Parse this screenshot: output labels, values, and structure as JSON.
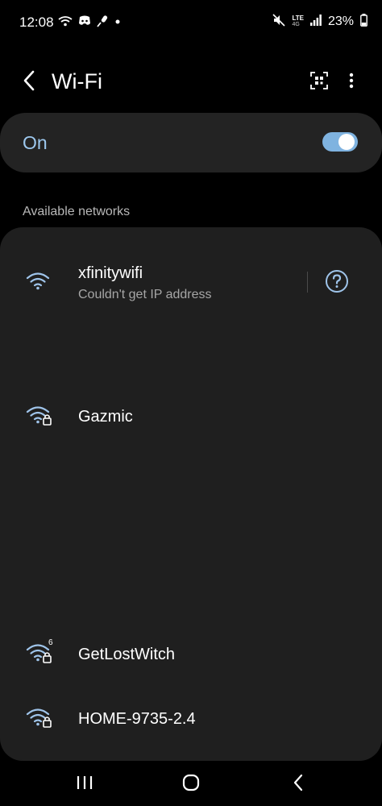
{
  "status_bar": {
    "time": "12:08",
    "battery": "23%",
    "network_type": "LTE",
    "network_subtype": "4G",
    "left_icons": [
      "wifi-icon",
      "discord-icon",
      "microphone-icon",
      "dot-icon"
    ],
    "right_icons": [
      "mute-icon",
      "lte-icon",
      "signal-icon",
      "battery-icon"
    ]
  },
  "header": {
    "title": "Wi-Fi",
    "back_icon": "chevron-left-icon",
    "qr_icon": "qr-scan-icon",
    "more_icon": "more-vertical-icon"
  },
  "wifi_toggle": {
    "label": "On",
    "state": true,
    "accent_color": "#7fb3e0"
  },
  "section_label": "Available networks",
  "networks": [
    {
      "name": "xfinitywifi",
      "status": "Couldn't get IP address",
      "secured": false,
      "badge": "",
      "icon": "wifi-icon"
    },
    {
      "name": "Gazmic",
      "status": "",
      "secured": true,
      "badge": "",
      "icon": "wifi-lock-icon"
    },
    {
      "name": "GetLostWitch",
      "status": "",
      "secured": true,
      "badge": "6",
      "icon": "wifi6-lock-icon"
    },
    {
      "name": "HOME-9735-2.4",
      "status": "",
      "secured": true,
      "badge": "",
      "icon": "wifi-lock-icon"
    }
  ],
  "navigation": {
    "recents_icon": "recents-icon",
    "home_icon": "home-icon",
    "back_icon": "back-icon"
  },
  "colors": {
    "background": "#000000",
    "card": "#1f1f1f",
    "toggle_card": "#232323",
    "toggle_label": "#9dc8ee",
    "icon_accent": "#9fc4ea"
  }
}
